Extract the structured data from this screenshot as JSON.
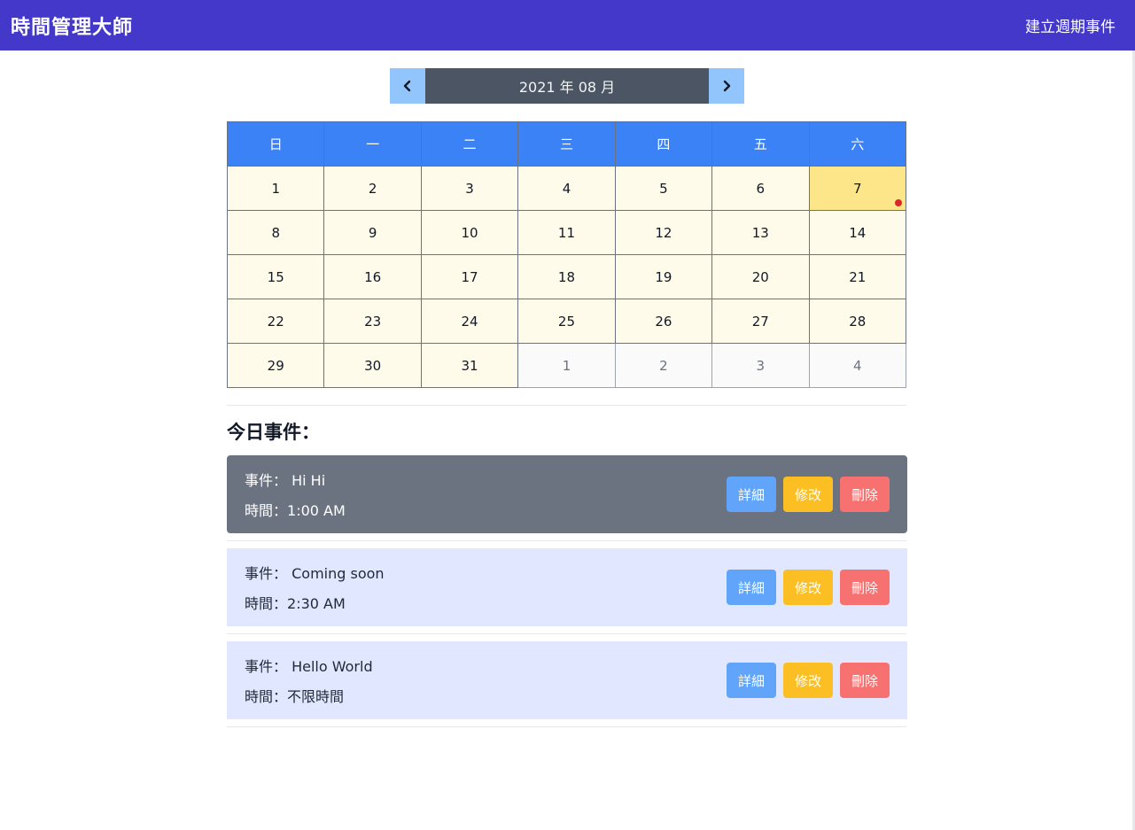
{
  "navbar": {
    "brand": "時間管理大師",
    "create_recurring": "建立週期事件"
  },
  "month_nav": {
    "label": "2021 年 08 月"
  },
  "calendar": {
    "weekdays": [
      "日",
      "一",
      "二",
      "三",
      "四",
      "五",
      "六"
    ],
    "weeks": [
      [
        "1",
        "2",
        "3",
        "4",
        "5",
        "6",
        "7"
      ],
      [
        "8",
        "9",
        "10",
        "11",
        "12",
        "13",
        "14"
      ],
      [
        "15",
        "16",
        "17",
        "18",
        "19",
        "20",
        "21"
      ],
      [
        "22",
        "23",
        "24",
        "25",
        "26",
        "27",
        "28"
      ],
      [
        "29",
        "30",
        "31",
        "1",
        "2",
        "3",
        "4"
      ]
    ],
    "today": "7",
    "accent_colors": {
      "header": "#3b82f6",
      "day": "#fffbeb",
      "today": "#fde68a",
      "event_dot": "#dc2626"
    }
  },
  "events": {
    "title": "今日事件：",
    "event_prefix": "事件：",
    "time_prefix": "時間：",
    "detail_label": "詳細",
    "edit_label": "修改",
    "delete_label": "刪除",
    "items": [
      {
        "name": "Hi Hi",
        "time": "1:00 AM"
      },
      {
        "name": "Coming soon",
        "time": "2:30 AM"
      },
      {
        "name": "Hello World",
        "time": "不限時間"
      }
    ]
  }
}
